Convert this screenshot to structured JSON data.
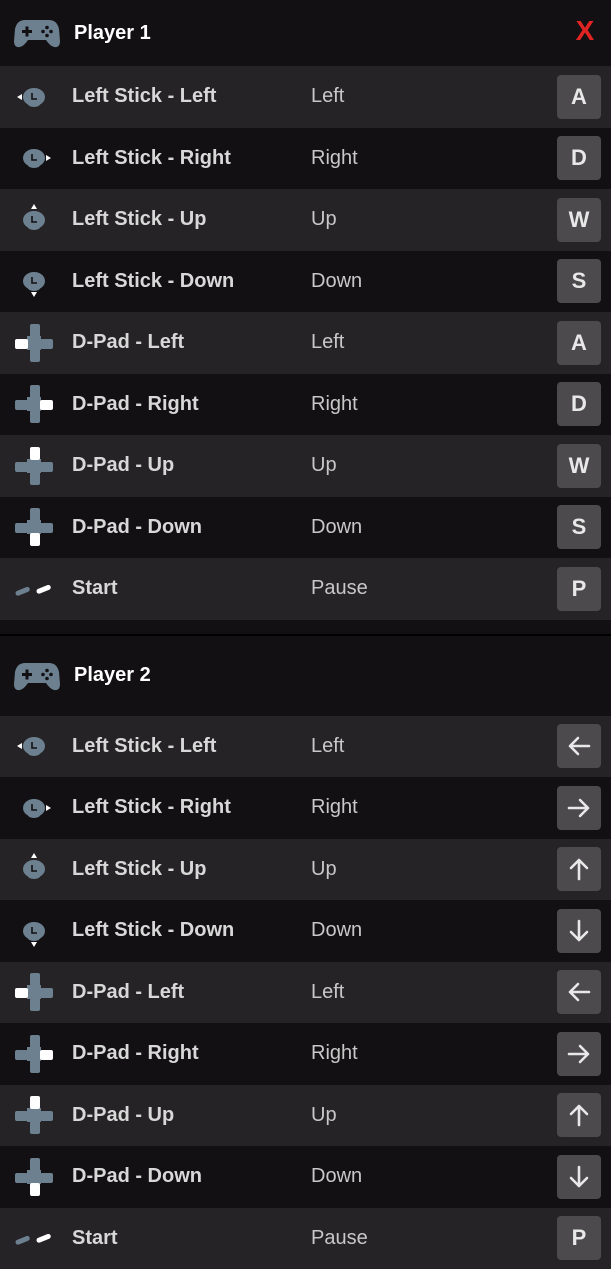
{
  "colors": {
    "close": "#e02424",
    "icon": "#6c8090",
    "highlight": "#ffffff"
  },
  "players": [
    {
      "title": "Player 1",
      "close_label": "X",
      "rows": [
        {
          "icon": "left-stick-left-icon",
          "action": "Left Stick - Left",
          "direction": "Left",
          "key": "A"
        },
        {
          "icon": "left-stick-right-icon",
          "action": "Left Stick - Right",
          "direction": "Right",
          "key": "D"
        },
        {
          "icon": "left-stick-up-icon",
          "action": "Left Stick - Up",
          "direction": "Up",
          "key": "W"
        },
        {
          "icon": "left-stick-down-icon",
          "action": "Left Stick - Down",
          "direction": "Down",
          "key": "S"
        },
        {
          "icon": "dpad-left-icon",
          "action": "D-Pad - Left",
          "direction": "Left",
          "key": "A"
        },
        {
          "icon": "dpad-right-icon",
          "action": "D-Pad - Right",
          "direction": "Right",
          "key": "D"
        },
        {
          "icon": "dpad-up-icon",
          "action": "D-Pad - Up",
          "direction": "Up",
          "key": "W"
        },
        {
          "icon": "dpad-down-icon",
          "action": "D-Pad - Down",
          "direction": "Down",
          "key": "S"
        },
        {
          "icon": "start-icon",
          "action": "Start",
          "direction": "Pause",
          "key": "P"
        }
      ]
    },
    {
      "title": "Player 2",
      "rows": [
        {
          "icon": "left-stick-left-icon",
          "action": "Left Stick - Left",
          "direction": "Left",
          "key": "arrow-left-icon"
        },
        {
          "icon": "left-stick-right-icon",
          "action": "Left Stick - Right",
          "direction": "Right",
          "key": "arrow-right-icon"
        },
        {
          "icon": "left-stick-up-icon",
          "action": "Left Stick - Up",
          "direction": "Up",
          "key": "arrow-up-icon"
        },
        {
          "icon": "left-stick-down-icon",
          "action": "Left Stick - Down",
          "direction": "Down",
          "key": "arrow-down-icon"
        },
        {
          "icon": "dpad-left-icon",
          "action": "D-Pad - Left",
          "direction": "Left",
          "key": "arrow-left-icon"
        },
        {
          "icon": "dpad-right-icon",
          "action": "D-Pad - Right",
          "direction": "Right",
          "key": "arrow-right-icon"
        },
        {
          "icon": "dpad-up-icon",
          "action": "D-Pad - Up",
          "direction": "Up",
          "key": "arrow-up-icon"
        },
        {
          "icon": "dpad-down-icon",
          "action": "D-Pad - Down",
          "direction": "Down",
          "key": "arrow-down-icon"
        },
        {
          "icon": "start-icon",
          "action": "Start",
          "direction": "Pause",
          "key": "P"
        }
      ]
    }
  ]
}
